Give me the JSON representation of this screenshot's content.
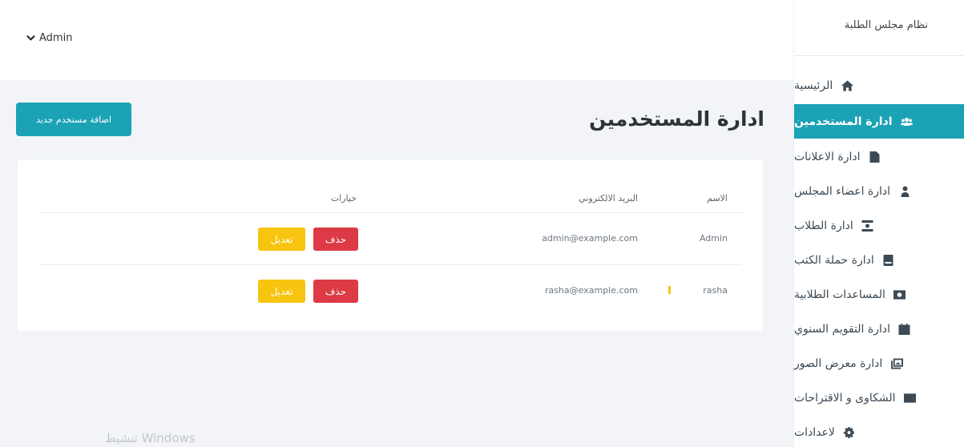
{
  "sidebar": {
    "brand": "نظام مجلس الطلبة",
    "items": [
      {
        "label": "الرئيسية",
        "icon": "home-icon",
        "active": false
      },
      {
        "label": "ادارة المستخدمين",
        "icon": "users-icon",
        "active": true
      },
      {
        "label": "ادارة الاعلانات",
        "icon": "file-icon",
        "active": false
      },
      {
        "label": "ادارة اعضاء المجلس",
        "icon": "sitemap-icon",
        "active": false
      },
      {
        "label": "ادارة الطلاب",
        "icon": "student-icon",
        "active": false
      },
      {
        "label": "ادارة حملة الكتب",
        "icon": "book-icon",
        "active": false
      },
      {
        "label": "المساعدات الطلابية",
        "icon": "money-icon",
        "active": false
      },
      {
        "label": "ادارة التقويم السنوي",
        "icon": "calendar-icon",
        "active": false
      },
      {
        "label": "ادارة معرض الصور",
        "icon": "images-icon",
        "active": false
      },
      {
        "label": "الشكاوى و الاقتراحات",
        "icon": "envelope-icon",
        "active": false
      },
      {
        "label": "لاعدادات",
        "icon": "gear-icon",
        "active": false
      }
    ]
  },
  "topbar": {
    "user": "Admin",
    "user_icon": "chevron-down-icon"
  },
  "main": {
    "title": "ادارة المستخدمين",
    "add_button": "اضافة مستخدم جديد",
    "table": {
      "headers": {
        "name": "الاسم",
        "email": "البريد الالكتروني",
        "options": "خيارات"
      },
      "rows": [
        {
          "name": "Admin",
          "email": "admin@example.com",
          "delete": "حذف",
          "edit": "تعديل"
        },
        {
          "name": "rasha",
          "email": "rasha@example.com",
          "delete": "حذف",
          "edit": "تعديل"
        }
      ]
    }
  },
  "watermark": "تنشيط Windows",
  "colors": {
    "accent": "#1ba2b5",
    "danger": "#dc3a45",
    "warning": "#f7c40f"
  }
}
